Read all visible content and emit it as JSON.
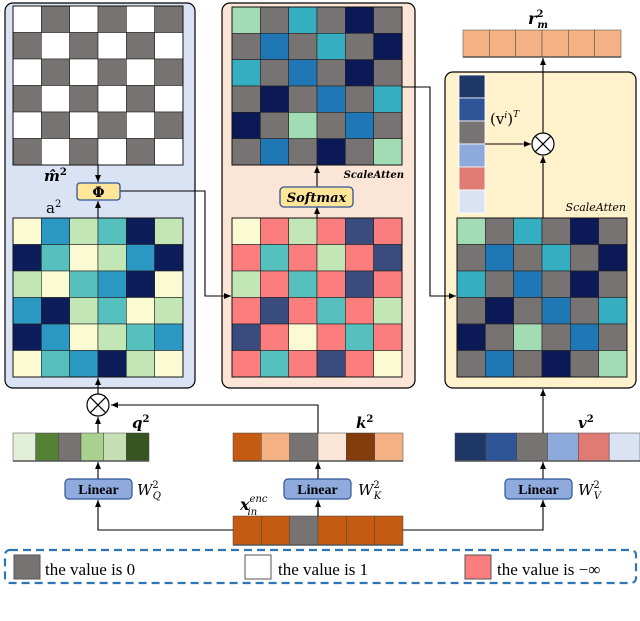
{
  "palette": {
    "G": "#787373",
    "W": "#ffffff",
    "P": "#fc7d7d",
    "C": "#fbfbd3",
    "B": "#2b98c4",
    "L": "#c3e6b6",
    "T": "#55c0bd",
    "N": "#0c1d5a",
    "S": "#3a4b7e",
    "g": "#a2dcb4",
    "t": "#35aec2",
    "b": "#1f78b5",
    "n": "#0b1a57"
  },
  "panels": {
    "left_bg": "#dae3f3",
    "middle_bg": "#fbe5d6",
    "right_bg": "#fff2cc",
    "op_box_fill": "#ffe699",
    "linear_fill": "#8faadc",
    "legend_border": "#2e75b6"
  },
  "grids": {
    "mask": [
      "WGWGWG",
      "GWGWGW",
      "WGWGWG",
      "GWGWGW",
      "WGWGWG",
      "GWGWGW"
    ],
    "a": [
      "CBLTNL",
      "NTCLBN",
      "LCTBNC",
      "BNLTCL",
      "NBCLTB",
      "CTBNLC"
    ],
    "masked": [
      "CPLPSP",
      "PTPLPS",
      "LPTPSP",
      "PSPTPL",
      "SPCPTP",
      "PTPSPC"
    ],
    "scale_atten": [
      "gGtGnG",
      "GbGtGn",
      "tGbGnG",
      "GnGbGt",
      "nGgGbG",
      "GbGnGg"
    ]
  },
  "vectors": {
    "r": [
      "#f4b183",
      "#f4b183",
      "#f4b183",
      "#f4b183",
      "#f4b183",
      "#f4b183"
    ],
    "v_col": [
      "#1f3766",
      "#2e5597",
      "#787373",
      "#8eaadc",
      "#e07b74",
      "#dae3f3"
    ],
    "q": [
      "#e2f0d9",
      "#548235",
      "#787373",
      "#a9d18e",
      "#c5e0b4",
      "#375623"
    ],
    "k": [
      "#c55a11",
      "#f4b183",
      "#787373",
      "#fbe5d6",
      "#843c0c",
      "#f4b183"
    ],
    "v": [
      "#1f3766",
      "#2e5597",
      "#787373",
      "#8eaadc",
      "#e07b74",
      "#dae3f3"
    ],
    "x": [
      "#c55a11",
      "#c55a11",
      "#787373",
      "#c55a11",
      "#c55a11",
      "#c55a11"
    ]
  },
  "labels": {
    "m_hat": "m̂",
    "m_sup": "2",
    "a": "a",
    "a_sup": "2",
    "phi": "Φ",
    "softmax": "Softmax",
    "scale_atten_1": "ScaleAtten",
    "scale_atten_2": "ScaleAtten",
    "r": "r",
    "r_sup": "2",
    "r_sub": "m",
    "vT_open": "(v",
    "vT_sup": "i",
    "vT_close": ")",
    "vT_T": "T",
    "q": "q",
    "q_sup": "2",
    "k": "k",
    "k_sup": "2",
    "v": "v",
    "v_sup": "2",
    "linear_q": "Linear",
    "linear_k": "Linear",
    "linear_v": "Linear",
    "W": "W",
    "W_sup": "2",
    "WQ_sub": "Q",
    "WK_sub": "K",
    "WV_sub": "V",
    "x": "x",
    "x_sup": "enc",
    "x_sub": "in"
  },
  "legend": {
    "items": [
      {
        "color": "#787373",
        "text": "the value is 0"
      },
      {
        "color": "#ffffff",
        "text": "the value is 1"
      },
      {
        "color": "#fc7d7d",
        "text": "the value is −∞"
      }
    ]
  }
}
